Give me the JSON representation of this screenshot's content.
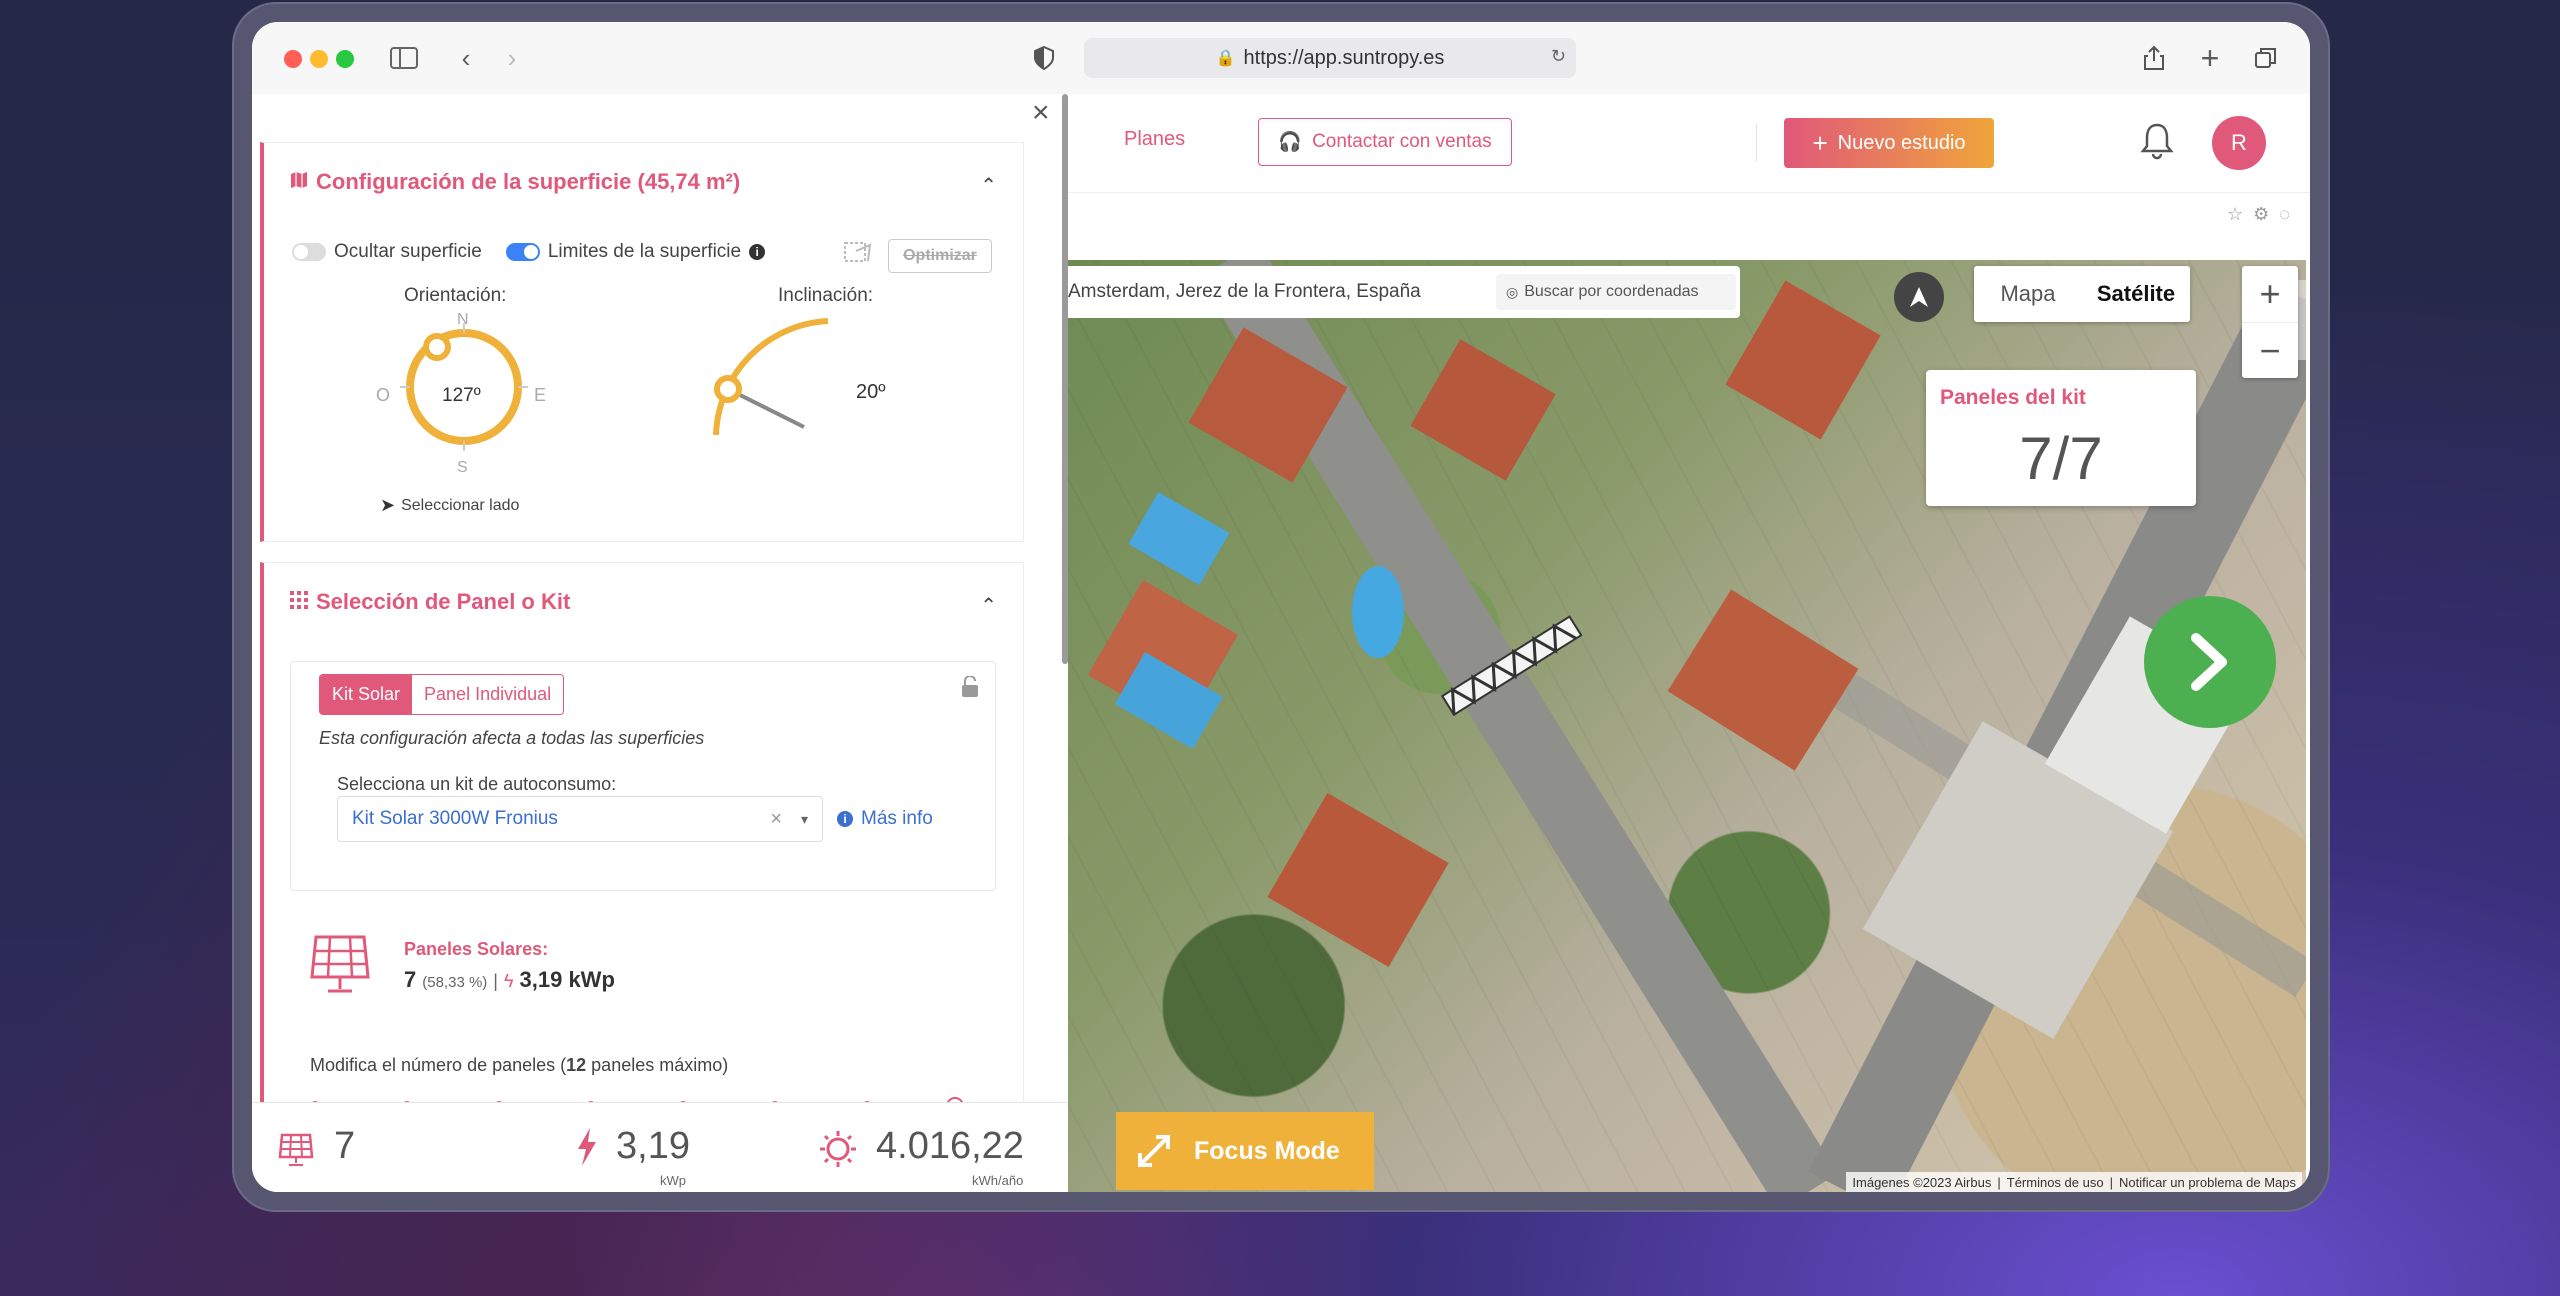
{
  "browser": {
    "url": "https://app.suntropy.es"
  },
  "surface_config": {
    "title": "Configuración de la superficie (45,74 m²)",
    "hide_surface_label": "Ocultar superficie",
    "hide_surface_on": false,
    "limits_label": "Limites de la superficie",
    "limits_on": true,
    "optimize_label": "Optimizar",
    "orientation_label": "Orientación:",
    "orientation_value": "127º",
    "compass": {
      "n": "N",
      "s": "S",
      "e": "E",
      "o": "O"
    },
    "inclination_label": "Inclinación:",
    "inclination_value": "20º",
    "select_side_label": "Seleccionar lado"
  },
  "panel_selection": {
    "title": "Selección de Panel o Kit",
    "tab_kit": "Kit Solar",
    "tab_panel": "Panel Individual",
    "note": "Esta configuración afecta a todas las superficies",
    "kit_select_label": "Selecciona un kit de autoconsumo:",
    "kit_selected": "Kit Solar 3000W Fronius",
    "more_info": "Más info",
    "solar_panels_label": "Paneles Solares:",
    "panel_count": "7",
    "panel_percent": "(58,33 %)",
    "separator": "|",
    "panel_power": "3,19 kWp",
    "modify_prefix": "Modifica el número de paneles (",
    "modify_max": "12",
    "modify_suffix": " paneles máximo)",
    "slider_fraction": 1.0
  },
  "footer": {
    "panels": "7",
    "power": "3,19",
    "power_unit": "kWp",
    "energy": "4.016,22",
    "energy_unit": "kWh/año"
  },
  "app_header": {
    "plans": "Planes",
    "contact_sales": "Contactar con ventas",
    "new_study": "Nuevo estudio",
    "avatar_initial": "R"
  },
  "map": {
    "address": "Amsterdam, Jerez de la Frontera, España",
    "coords_button": "Buscar por coordenadas",
    "tab_map": "Mapa",
    "tab_satellite": "Satélite",
    "zoom_in": "+",
    "zoom_out": "−",
    "kit_panels_label": "Paneles del kit",
    "kit_panels_value": "7/7",
    "focus_mode": "Focus Mode",
    "attribution": "Imágenes ©2023 Airbus",
    "terms": "Términos de uso",
    "report": "Notificar un problema de Maps"
  },
  "colors": {
    "accent": "#e0587a",
    "orange": "#f0b13a",
    "green": "#4caf50",
    "blue": "#3b82f6"
  }
}
